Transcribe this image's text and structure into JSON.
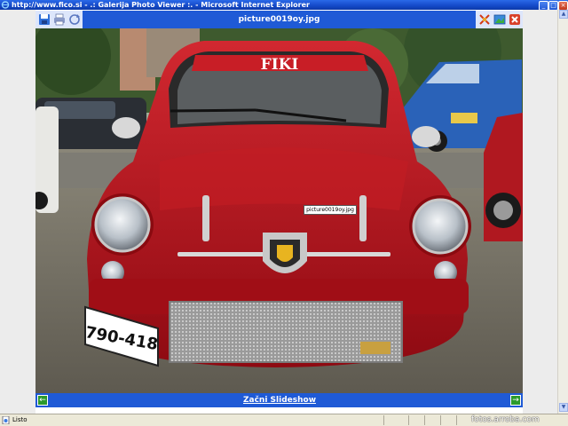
{
  "window": {
    "title": "http://www.fico.si - .: Galerija Photo Viewer :. - Microsoft Internet Explorer",
    "minimize": "_",
    "maximize": "□",
    "close": "×"
  },
  "viewer": {
    "image_title": "picture0019oy.jpg",
    "caption": "picture0019oy.jpg",
    "slideshow_label": "Začni Slideshow",
    "prev_arrow": "←",
    "next_arrow": "→"
  },
  "photo_text": {
    "windshield": "FIKI",
    "plate": "790-418"
  },
  "icons": {
    "save": "floppy-disk-icon",
    "print": "printer-icon",
    "refresh": "refresh-icon",
    "fit": "fit-screen-icon",
    "fullsize": "full-size-icon",
    "close": "close-viewer-icon"
  },
  "statusbar": {
    "text": "Listo"
  },
  "watermark": "fotos.arroba.com",
  "colors": {
    "viewer_blue": "#1f5ad6",
    "toolbar_bg": "#dde6fb",
    "nav_green": "#2c9a2c",
    "car_red": "#b8121c"
  }
}
